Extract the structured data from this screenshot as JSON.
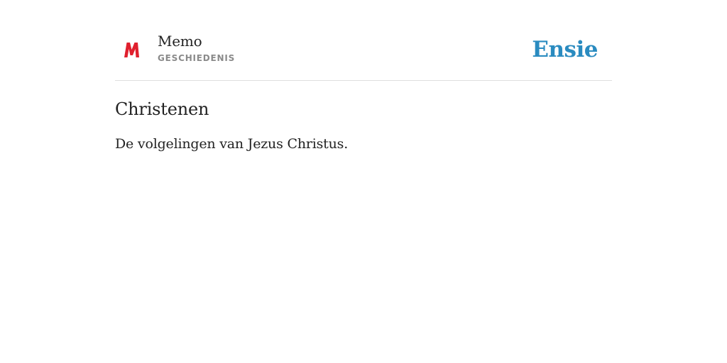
{
  "header": {
    "logo_icon": "memo-m-logo-icon",
    "logo_color": "#e0202e",
    "app_name": "Memo",
    "subject": "GESCHIEDENIS",
    "brand": "Ensie",
    "brand_color": "#2a8bc0"
  },
  "entry": {
    "term": "Christenen",
    "definition": "De volgelingen van Jezus Christus."
  }
}
